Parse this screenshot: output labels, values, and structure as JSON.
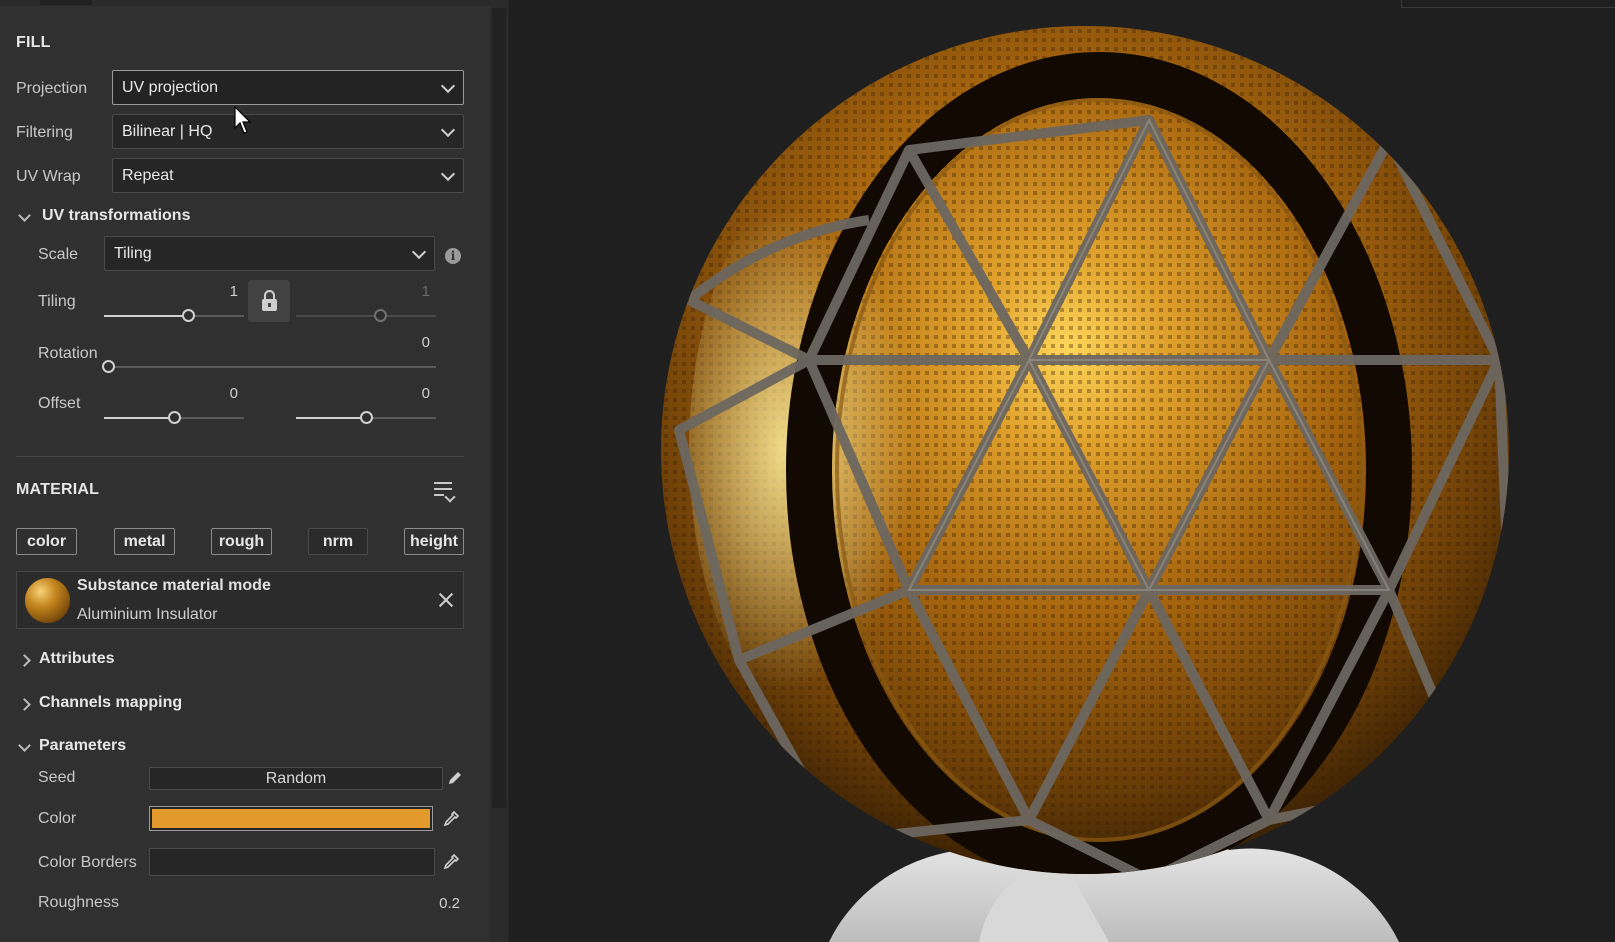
{
  "fill": {
    "title": "FILL",
    "projection": {
      "label": "Projection",
      "value": "UV projection"
    },
    "filtering": {
      "label": "Filtering",
      "value": "Bilinear | HQ"
    },
    "uv_wrap": {
      "label": "UV Wrap",
      "value": "Repeat"
    },
    "uv_transformations": {
      "title": "UV transformations",
      "expanded": true,
      "scale": {
        "label": "Scale",
        "value": "Tiling"
      },
      "tiling": {
        "label": "Tiling",
        "u": "1",
        "v": "1",
        "u_fraction": 0.6,
        "v_fraction": 0.6,
        "locked": true
      },
      "rotation": {
        "label": "Rotation",
        "value": "0",
        "fraction": 0.0
      },
      "offset": {
        "label": "Offset",
        "u": "0",
        "v": "0",
        "u_fraction": 0.5,
        "v_fraction": 0.5
      }
    }
  },
  "material": {
    "title": "MATERIAL",
    "channels": [
      "color",
      "metal",
      "rough",
      "nrm",
      "height"
    ],
    "card": {
      "title": "Substance material mode",
      "name": "Aluminium Insulator"
    },
    "attributes": "Attributes",
    "channels_mapping": "Channels mapping",
    "parameters": {
      "title": "Parameters",
      "seed": {
        "label": "Seed",
        "value": "Random"
      },
      "color": {
        "label": "Color",
        "hex": "#e39a2c"
      },
      "color_borders": {
        "label": "Color Borders",
        "hex": "#262626"
      },
      "roughness": {
        "label": "Roughness",
        "value": "0.2"
      }
    }
  },
  "icons": [
    "chevron-down-icon",
    "lock-icon",
    "info-icon",
    "list-menu-icon",
    "close-icon",
    "eyedropper-icon",
    "pencil-icon"
  ],
  "colors": {
    "panel_bg": "#303030",
    "viewport_bg": "#1f1f1f",
    "accent_gold": "#e39a2c"
  }
}
